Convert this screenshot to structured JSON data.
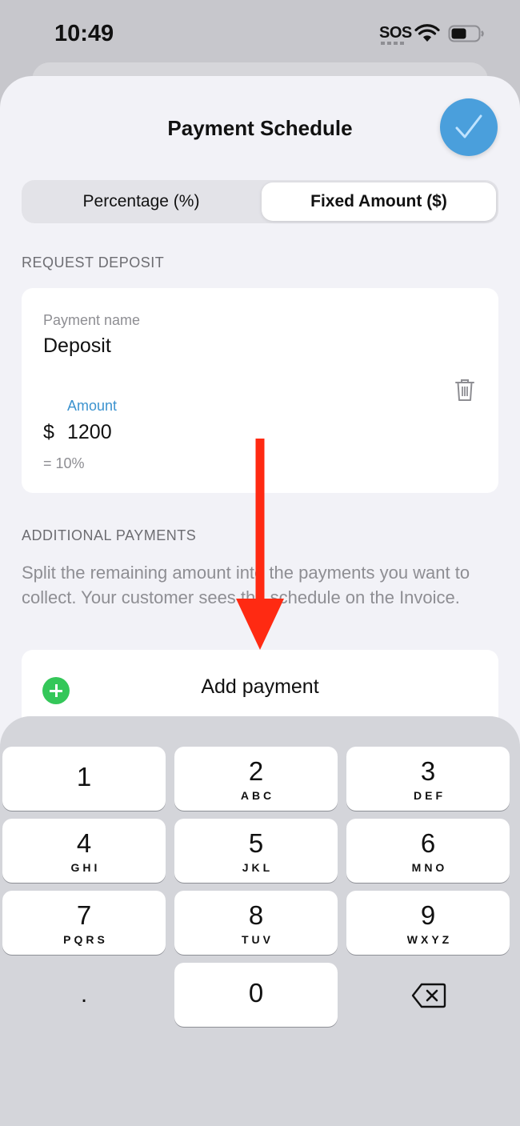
{
  "status_bar": {
    "time": "10:49",
    "sos": "SOS"
  },
  "sheet": {
    "title": "Payment Schedule",
    "done_icon": "checkmark-icon",
    "accent_color": "#4a9fdc"
  },
  "segmented": {
    "left_label": "Percentage (%)",
    "right_label": "Fixed Amount ($)",
    "selected": "Fixed Amount ($)"
  },
  "deposit": {
    "header": "REQUEST DEPOSIT",
    "name_label": "Payment name",
    "name_value": "Deposit",
    "amount_label": "Amount",
    "currency": "$",
    "amount_value": "1200",
    "percent_note": "= 10%"
  },
  "additional": {
    "header": "ADDITIONAL PAYMENTS",
    "help_text": "Split the remaining amount into the payments you want to collect. Your customer sees the schedule on the Invoice.",
    "add_label": "Add payment"
  },
  "keypad": {
    "keys": [
      {
        "digit": "1",
        "letters": ""
      },
      {
        "digit": "2",
        "letters": "ABC"
      },
      {
        "digit": "3",
        "letters": "DEF"
      },
      {
        "digit": "4",
        "letters": "GHI"
      },
      {
        "digit": "5",
        "letters": "JKL"
      },
      {
        "digit": "6",
        "letters": "MNO"
      },
      {
        "digit": "7",
        "letters": "PQRS"
      },
      {
        "digit": "8",
        "letters": "TUV"
      },
      {
        "digit": "9",
        "letters": "WXYZ"
      },
      {
        "digit": "0",
        "letters": ""
      }
    ],
    "decimal": "."
  }
}
